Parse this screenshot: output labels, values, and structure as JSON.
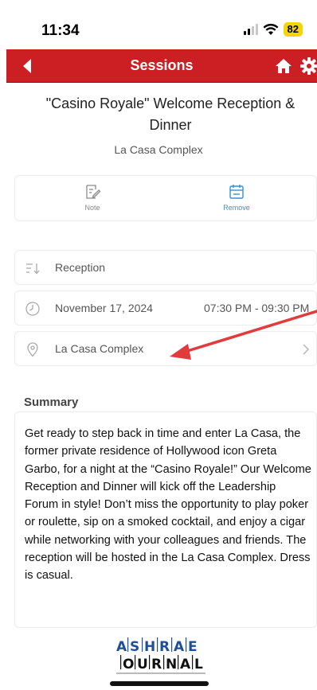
{
  "status_bar": {
    "time": "11:34",
    "battery": "82"
  },
  "navbar": {
    "title": "Sessions"
  },
  "session": {
    "title": "\"Casino Royale\" Welcome Reception & Dinner",
    "venue": "La Casa Complex"
  },
  "actions": {
    "note_label": "Note",
    "remove_label": "Remove"
  },
  "details": {
    "type": "Reception",
    "date": "November 17, 2024",
    "time": "07:30 PM - 09:30 PM",
    "location": "La Casa Complex"
  },
  "summary": {
    "heading": "Summary",
    "body": "Get ready to step back in time and enter La Casa, the former private residence of Hollywood icon Greta Garbo, for a night at the “Casino Royale!” Our Welcome Reception and Dinner will kick off the Leadership Forum in style! Don’t miss the opportunity to play poker or roulette, sip on a smoked cocktail, and enjoy a cigar while networking with your colleagues and friends. The reception will be hosted in the La Casa Complex. Dress is casual."
  },
  "logo": {
    "row1": [
      "A",
      "S",
      "H",
      "R",
      "A",
      "E"
    ],
    "row2": [
      "J",
      "O",
      "U",
      "R",
      "N",
      "A",
      "L"
    ]
  },
  "colors": {
    "brand_red": "#cc1f24",
    "accent_blue": "#3b8fd6",
    "annotation_arrow": "#e23b3b",
    "battery": "#f5d50a"
  }
}
